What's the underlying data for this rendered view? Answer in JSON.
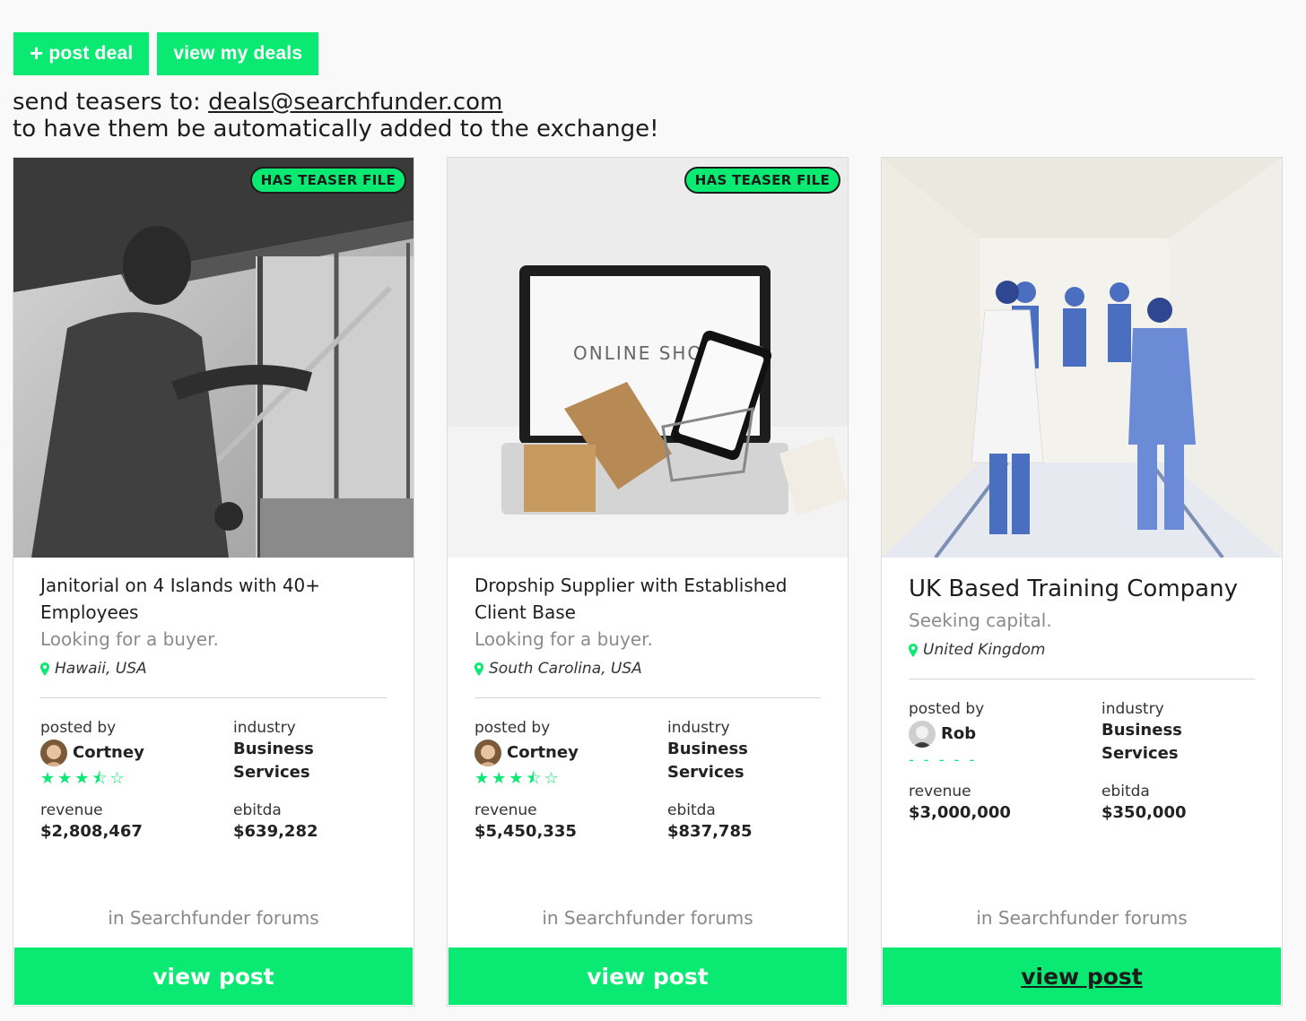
{
  "toolbar": {
    "post_deal_label": "post deal",
    "view_my_deals_label": "view my deals"
  },
  "teaser_note": {
    "line1_prefix": "send teasers to: ",
    "email": "deals@searchfunder.com",
    "line2": "to have them be automatically added to the exchange!"
  },
  "labels": {
    "posted_by": "posted by",
    "industry": "industry",
    "revenue": "revenue",
    "ebitda": "ebitda",
    "forum": "in Searchfunder forums",
    "view_post": "view post",
    "teaser_badge": "HAS TEASER FILE"
  },
  "deals": [
    {
      "title": "Janitorial on 4 Islands with 40+ Employees",
      "subtitle": "Looking for a buyer.",
      "location": "Hawaii, USA",
      "poster": "Cortney",
      "rating": 3.5,
      "industry": "Business Services",
      "revenue": "$2,808,467",
      "ebitda": "$639,282"
    },
    {
      "title": "Dropship Supplier with Established Client Base",
      "subtitle": "Looking for a buyer.",
      "location": "South Carolina, USA",
      "poster": "Cortney",
      "rating": 3.5,
      "industry": "Business Services",
      "revenue": "$5,450,335",
      "ebitda": "$837,785"
    },
    {
      "title": "UK Based Training Company",
      "subtitle": "Seeking capital.",
      "location": "United Kingdom",
      "poster": "Rob",
      "rating_placeholder": "- - - - -",
      "industry": "Business Services",
      "revenue": "$3,000,000",
      "ebitda": "$350,000"
    }
  ],
  "colors": {
    "accent": "#0aea72"
  }
}
